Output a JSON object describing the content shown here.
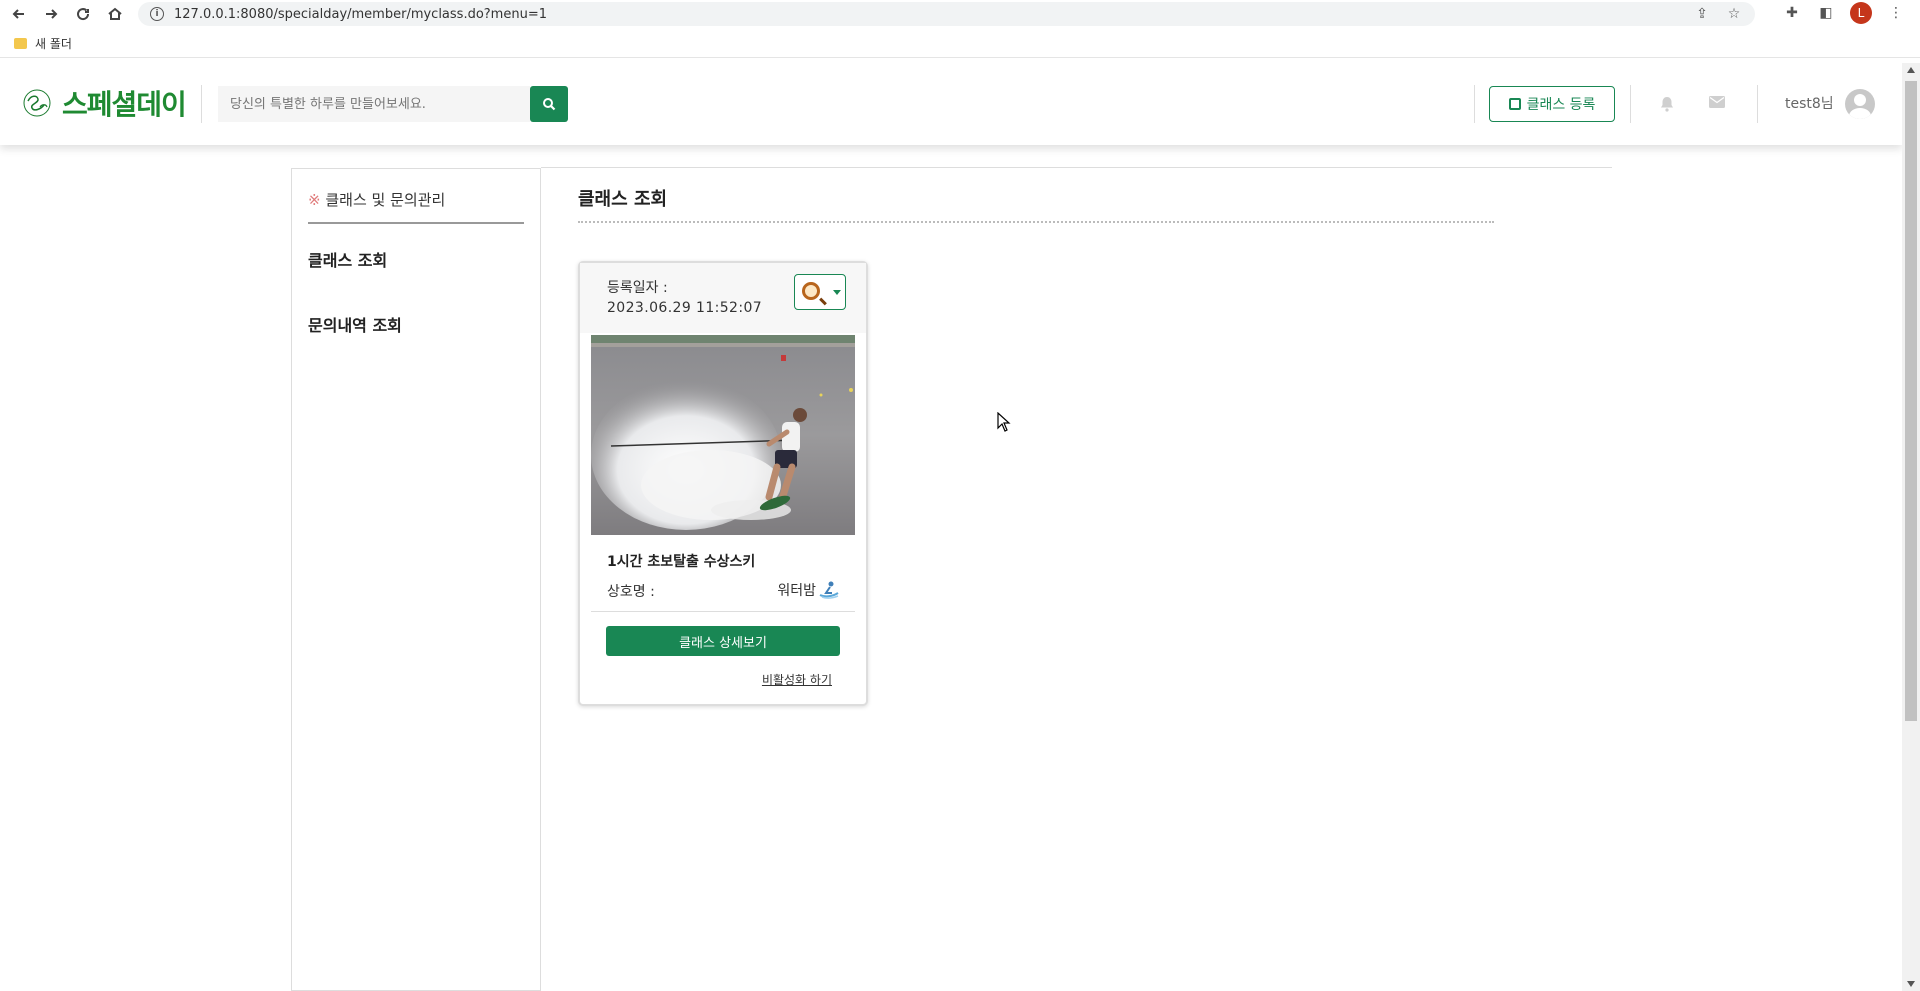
{
  "browser": {
    "url": "127.0.0.1:8080/specialday/member/myclass.do?menu=1",
    "profile_initial": "L",
    "bookmark_label": "새 폴더"
  },
  "header": {
    "logo_mark": "Special Day",
    "logo_text": "스페셜데이",
    "search_placeholder": "당신의 특별한 하루를 만들어보세요.",
    "register_label": "클래스 등록",
    "username": "test8님"
  },
  "sidebar": {
    "title_mark": "※",
    "title": "클래스 및 문의관리",
    "items": [
      {
        "label": "클래스 조회"
      },
      {
        "label": "문의내역 조회"
      }
    ]
  },
  "main": {
    "title": "클래스 조회",
    "card": {
      "date_label": "등록일자 :",
      "date_value": "2023.06.29 11:52:07",
      "class_title": "1시간 초보탈출 수상스키",
      "company_label": "상호명 :",
      "company_name": "워터밤",
      "detail_button": "클래스 상세보기",
      "deactivate_link": "비활성화 하기"
    }
  },
  "colors": {
    "accent": "#198754",
    "logo_green": "#1f8a32"
  }
}
